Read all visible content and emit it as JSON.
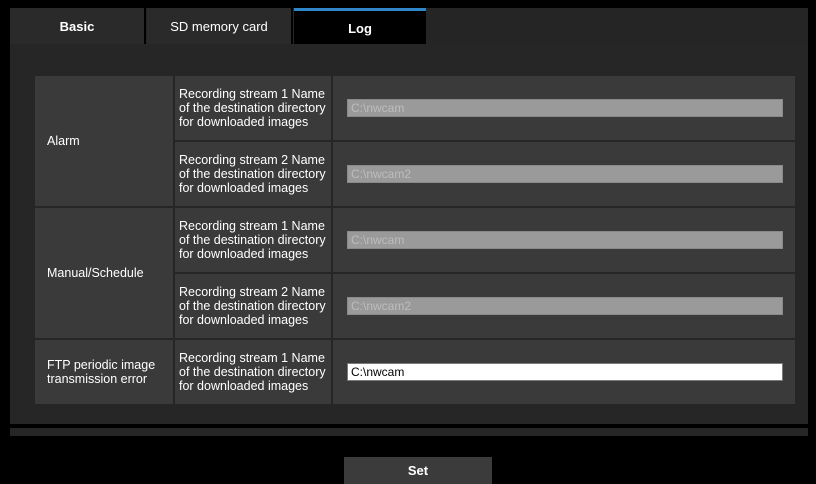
{
  "tabs": {
    "basic": "Basic",
    "sd": "SD memory card",
    "log": "Log"
  },
  "rows": {
    "alarm": {
      "group": "Alarm",
      "stream1_label": "Recording stream 1 Name of the destination directory for downloaded images",
      "stream1_value": "C:\\nwcam",
      "stream2_label": "Recording stream 2 Name of the destination directory for downloaded images",
      "stream2_value": "C:\\nwcam2"
    },
    "manual": {
      "group": "Manual/Schedule",
      "stream1_label": "Recording stream 1 Name of the destination directory for downloaded images",
      "stream1_value": "C:\\nwcam",
      "stream2_label": "Recording stream 2 Name of the destination directory for downloaded images",
      "stream2_value": "C:\\nwcam2"
    },
    "ftp": {
      "group": "FTP periodic image transmission error",
      "stream1_label": "Recording stream 1 Name of the destination directory for downloaded images",
      "stream1_value": "C:\\nwcam"
    }
  },
  "buttons": {
    "set": "Set"
  },
  "colors": {
    "accent": "#2f86c8",
    "panel": "#262626",
    "cell": "#3a3a3a",
    "disabled_input": "#9a9a9a"
  }
}
